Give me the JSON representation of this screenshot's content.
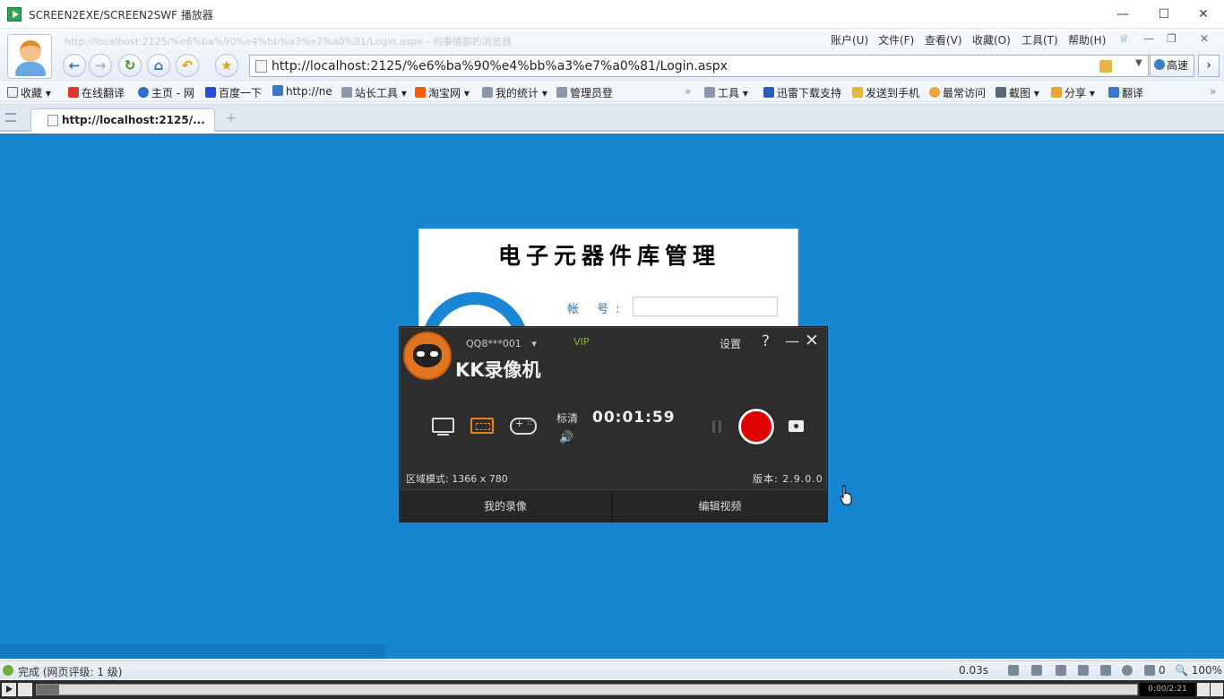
{
  "window": {
    "title": "SCREEN2EXE/SCREEN2SWF 播放器",
    "minimize": "—",
    "maximize": "☐",
    "close": "✕"
  },
  "browser": {
    "ghost_url": "http://localhost:2125/%e6%ba%90%e4%bb%a3%e7%a0%81/Login.aspx - 何事情都的浏览器",
    "menu": [
      "账户(U)",
      "文件(F)",
      "查看(V)",
      "收藏(O)",
      "工具(T)",
      "帮助(H)"
    ],
    "address": "http://localhost:2125/%e6%ba%90%e4%bb%a3%e7%a0%81/Login.aspx",
    "speed_label": "高速",
    "go_label": "›",
    "favorites_left": [
      {
        "label": "收藏",
        "color": "#f3f3f3"
      },
      {
        "label": "在线翻译",
        "color": "#d93a2b"
      },
      {
        "label": "主页 - 网",
        "color": "#2d6ec9"
      },
      {
        "label": "百度一下",
        "color": "#2b4fd1"
      },
      {
        "label": "http://ne",
        "color": "#3a77c6"
      },
      {
        "label": "站长工具",
        "color": "#8a99aa"
      },
      {
        "label": "淘宝网",
        "color": "#f25c05"
      },
      {
        "label": "我的统计",
        "color": "#8a99aa"
      },
      {
        "label": "管理员登",
        "color": "#8a99aa"
      }
    ],
    "favorites_right": [
      {
        "label": "工具",
        "color": "#8a99aa"
      },
      {
        "label": "迅雷下载支持",
        "color": "#2a5fb8"
      },
      {
        "label": "发送到手机",
        "color": "#e7b642"
      },
      {
        "label": "最常访问",
        "color": "#e7a53a"
      },
      {
        "label": "截图",
        "color": "#5a6a7a"
      },
      {
        "label": "分享",
        "color": "#e7a53a"
      },
      {
        "label": "翻译",
        "color": "#3a77c6"
      }
    ],
    "tab_label": "http://localhost:2125/...",
    "status_text": "完成 (网页评级: 1 级)",
    "timing": "0.03s",
    "counter": "0",
    "zoom": "100%"
  },
  "page": {
    "background": "#1586cf",
    "heading": "电子元器件库管理",
    "account_label": "帐  号:"
  },
  "recorder": {
    "account": "QQ8***001",
    "vip": "VIP",
    "brand": "KK录像机",
    "settings": "设置",
    "help": "?",
    "minimize": "—",
    "close": "✕",
    "quality": "标清",
    "timer": "00:01:59",
    "region_mode": "区域模式: 1366 x 780",
    "version": "版本: 2.9.0.0",
    "my_recordings": "我的录像",
    "edit_video": "编辑视频"
  },
  "player": {
    "time": "0:00/2:21",
    "progress": 0.02
  }
}
